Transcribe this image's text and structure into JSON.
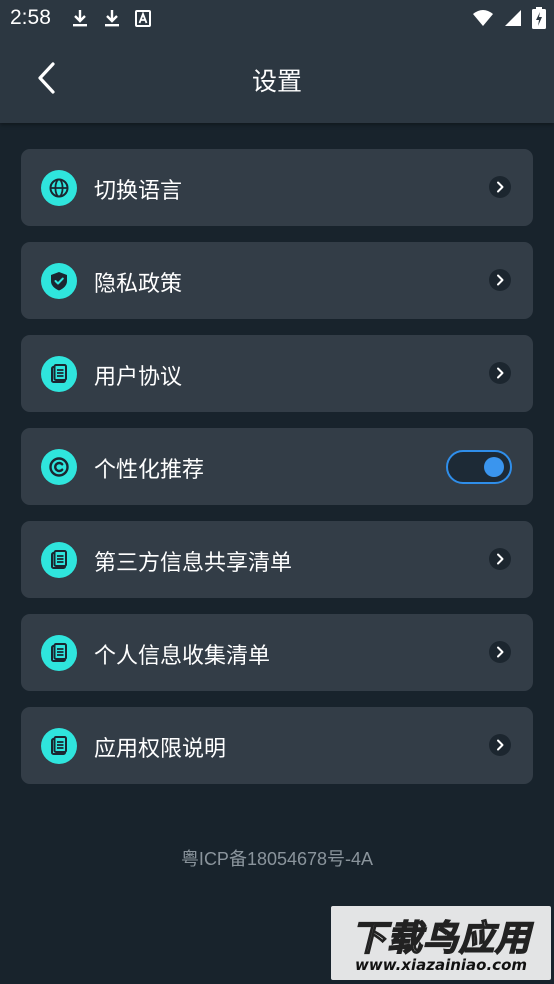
{
  "status_bar": {
    "time": "2:58",
    "left_icons": [
      "download-icon",
      "download-icon",
      "notification-a-icon"
    ],
    "right_icons": [
      "wifi-icon",
      "signal-icon",
      "battery-charging-icon"
    ]
  },
  "header": {
    "back_icon": "chevron-left-icon",
    "title": "设置"
  },
  "settings": {
    "items": [
      {
        "label": "切换语言",
        "icon": "globe-icon",
        "control": "arrow"
      },
      {
        "label": "隐私政策",
        "icon": "shield-check-icon",
        "control": "arrow"
      },
      {
        "label": "用户协议",
        "icon": "document-icon",
        "control": "arrow"
      },
      {
        "label": "个性化推荐",
        "icon": "copyright-icon",
        "control": "toggle",
        "toggle_on": true
      },
      {
        "label": "第三方信息共享清单",
        "icon": "document-icon",
        "control": "arrow"
      },
      {
        "label": "个人信息收集清单",
        "icon": "document-icon",
        "control": "arrow"
      },
      {
        "label": "应用权限说明",
        "icon": "document-icon",
        "control": "arrow"
      }
    ]
  },
  "footer": {
    "icp": "粤ICP备18054678号-4A"
  },
  "watermark": {
    "title": "下载鸟应用",
    "url": "www.xiazainiao.com"
  },
  "colors": {
    "background": "#18232c",
    "header": "#2c3741",
    "card": "#333d47",
    "icon_accent": "#2fe5dd",
    "toggle_accent": "#2f8eea",
    "icp_text": "#8a949c"
  }
}
